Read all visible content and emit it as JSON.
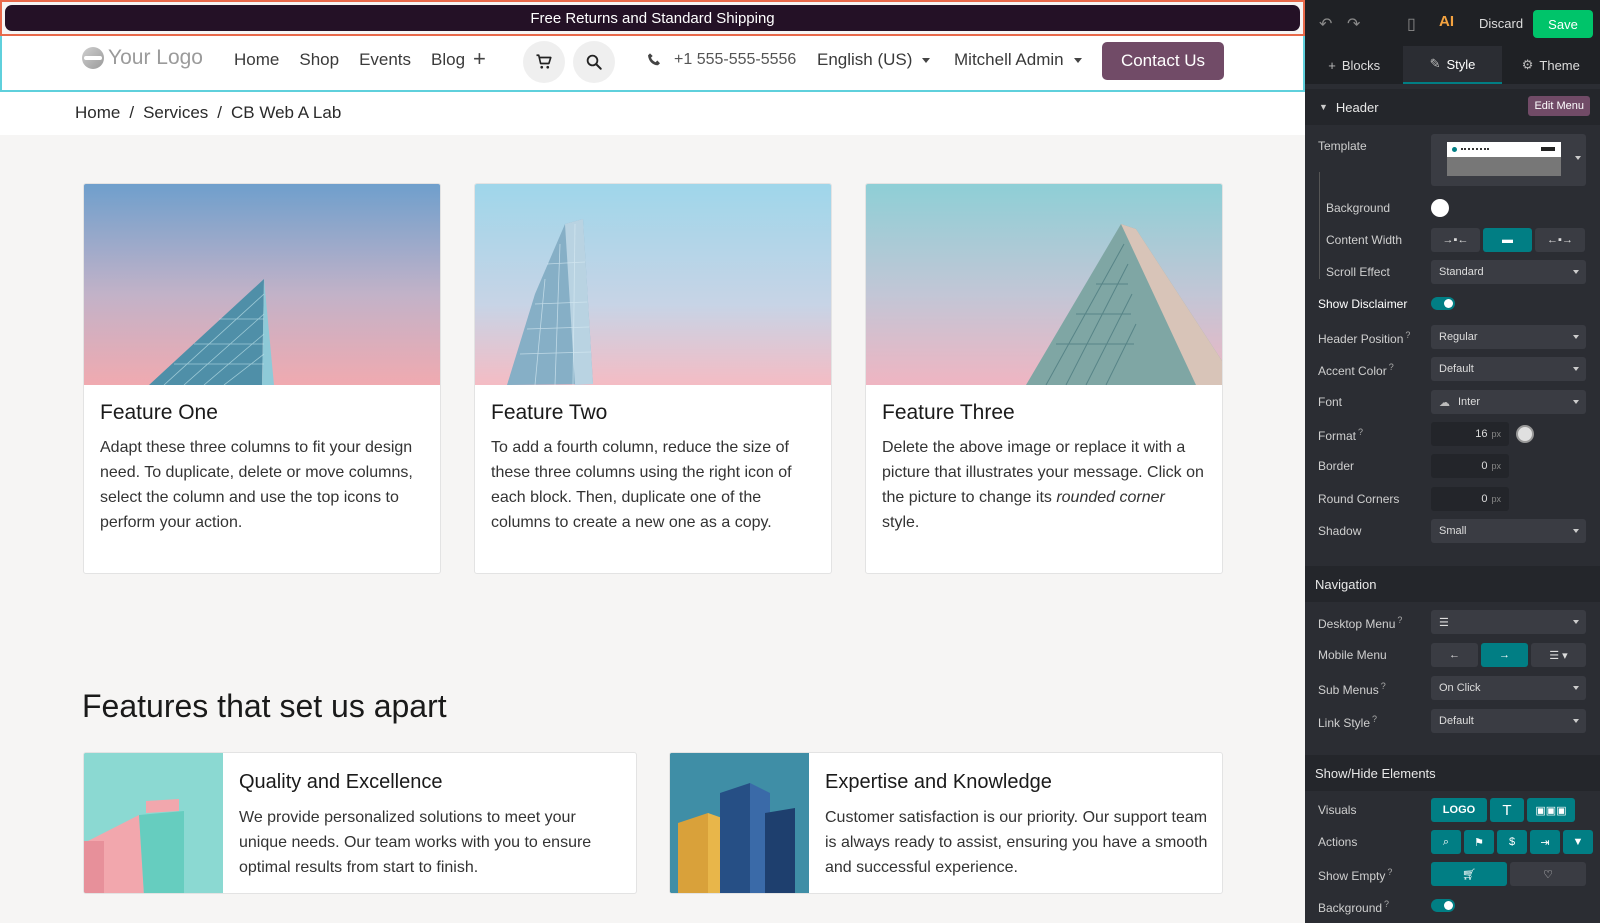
{
  "site": {
    "disclaimer": "Free Returns and Standard Shipping",
    "logo_text": "Your Logo",
    "nav": [
      "Home",
      "Shop",
      "Events",
      "Blog"
    ],
    "phone": "+1 555-555-5556",
    "language": "English (US)",
    "user": "Mitchell Admin",
    "contact_button": "Contact Us",
    "breadcrumb": [
      "Home",
      "/",
      "Services",
      "/",
      "CB Web A Lab"
    ],
    "cards": [
      {
        "title": "Feature One",
        "text": "Adapt these three columns to fit your design need. To duplicate, delete or move columns, select the column and use the top icons to perform your action."
      },
      {
        "title": "Feature Two",
        "text": "To add a fourth column, reduce the size of these three columns using the right icon of each block. Then, duplicate one of the columns to create a new one as a copy."
      },
      {
        "title": "Feature Three",
        "text_before": "Delete the above image or replace it with a picture that illustrates your message. Click on the picture to change its ",
        "text_italic1": "rounded corner",
        "text_after": " style."
      }
    ],
    "section_title": "Features that set us apart",
    "features": [
      {
        "title": "Quality and Excellence",
        "text": "We provide personalized solutions to meet your unique needs. Our team works with you to ensure optimal results from start to finish."
      },
      {
        "title": "Expertise and Knowledge",
        "text": "Customer satisfaction is our priority. Our support team is always ready to assist, ensuring you have a smooth and successful experience."
      }
    ]
  },
  "panel": {
    "discard": "Discard",
    "save": "Save",
    "tabs": {
      "blocks": "Blocks",
      "style": "Style",
      "theme": "Theme"
    },
    "header_section": "Header",
    "edit_menu": "Edit Menu",
    "template_label": "Template",
    "background_label": "Background",
    "content_width_label": "Content Width",
    "scroll_effect_label": "Scroll Effect",
    "scroll_effect_value": "Standard",
    "show_disclaimer_label": "Show Disclaimer",
    "header_position_label": "Header Position",
    "header_position_value": "Regular",
    "accent_color_label": "Accent Color",
    "accent_color_value": "Default",
    "font_label": "Font",
    "font_value": "Inter",
    "format_label": "Format",
    "format_value": "16",
    "border_label": "Border",
    "border_value": "0",
    "round_corners_label": "Round Corners",
    "round_corners_value": "0",
    "px": "px",
    "q": "?",
    "shadow_label": "Shadow",
    "shadow_value": "Small",
    "navigation_section": "Navigation",
    "desktop_menu_label": "Desktop Menu",
    "mobile_menu_label": "Mobile Menu",
    "sub_menus_label": "Sub Menus",
    "sub_menus_value": "On Click",
    "link_style_label": "Link Style",
    "link_style_value": "Default",
    "showhide_section": "Show/Hide Elements",
    "visuals_label": "Visuals",
    "visuals_logo": "LOGO",
    "actions_label": "Actions",
    "show_empty_label": "Show Empty",
    "background2_label": "Background"
  },
  "colors": {
    "brand": "#714b67",
    "accent": "#017e84",
    "save": "#00c46a",
    "disclaimer_bg": "#241126"
  }
}
